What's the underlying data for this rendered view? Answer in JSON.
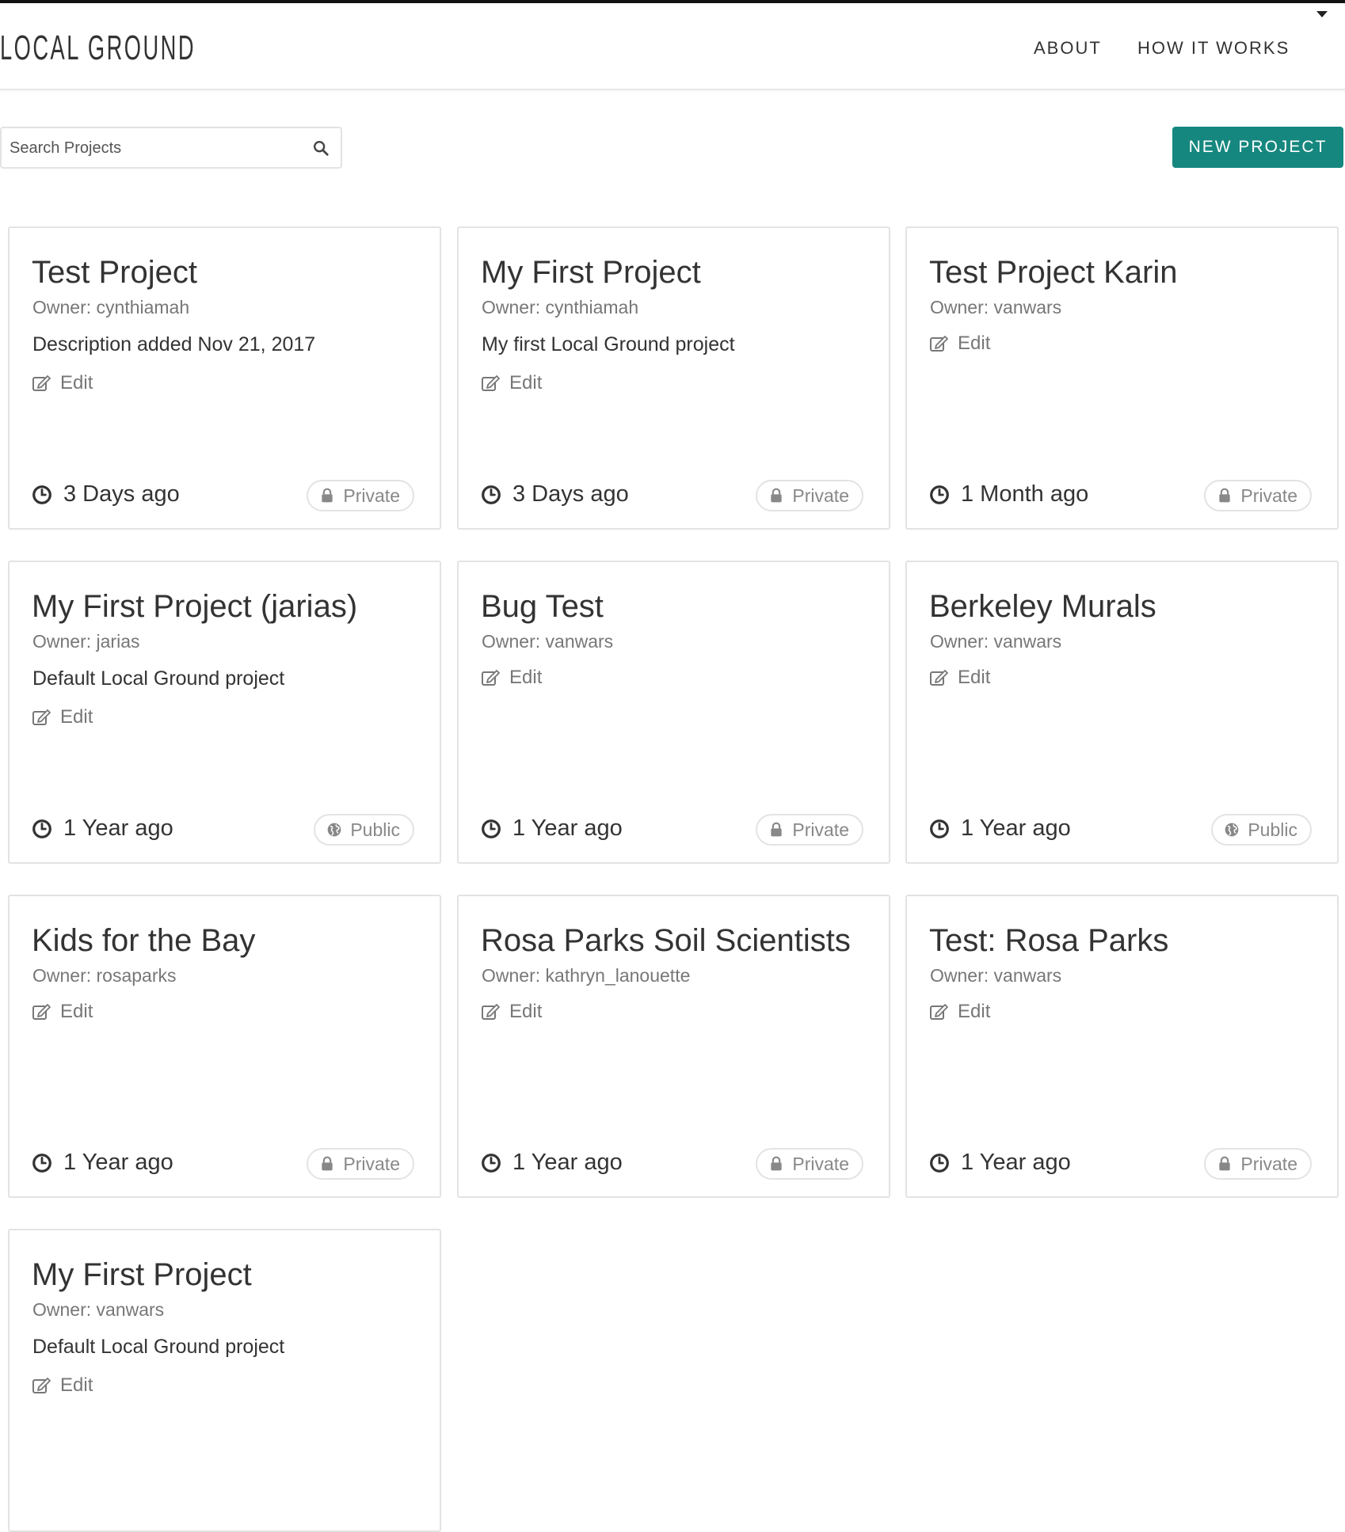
{
  "header": {
    "logo": "LOCAL GROUND",
    "nav": [
      "ABOUT",
      "HOW IT WORKS"
    ]
  },
  "search": {
    "placeholder": "Search Projects",
    "value": ""
  },
  "toolbar": {
    "new_project_label": "NEW PROJECT",
    "accent_color": "#16877f"
  },
  "projects": [
    {
      "title": "Test Project",
      "owner": "Owner: cynthiamah",
      "description": "Description added Nov 21, 2017",
      "edit": "Edit",
      "time": "3 Days ago",
      "visibility": "Private"
    },
    {
      "title": "My First Project",
      "owner": "Owner: cynthiamah",
      "description": "My first Local Ground project",
      "edit": "Edit",
      "time": "3 Days ago",
      "visibility": "Private"
    },
    {
      "title": "Test Project Karin",
      "owner": "Owner: vanwars",
      "description": "",
      "edit": "Edit",
      "time": "1 Month ago",
      "visibility": "Private"
    },
    {
      "title": "My First Project (jarias)",
      "owner": "Owner: jarias",
      "description": "Default Local Ground project",
      "edit": "Edit",
      "time": "1 Year ago",
      "visibility": "Public"
    },
    {
      "title": "Bug Test",
      "owner": "Owner: vanwars",
      "description": "",
      "edit": "Edit",
      "time": "1 Year ago",
      "visibility": "Private"
    },
    {
      "title": "Berkeley Murals",
      "owner": "Owner: vanwars",
      "description": "",
      "edit": "Edit",
      "time": "1 Year ago",
      "visibility": "Public"
    },
    {
      "title": "Kids for the Bay",
      "owner": "Owner: rosaparks",
      "description": "",
      "edit": "Edit",
      "time": "1 Year ago",
      "visibility": "Private"
    },
    {
      "title": "Rosa Parks Soil Scientists",
      "owner": "Owner: kathryn_lanouette",
      "description": "",
      "edit": "Edit",
      "time": "1 Year ago",
      "visibility": "Private"
    },
    {
      "title": "Test: Rosa Parks",
      "owner": "Owner: vanwars",
      "description": "",
      "edit": "Edit",
      "time": "1 Year ago",
      "visibility": "Private"
    },
    {
      "title": "My First Project",
      "owner": "Owner: vanwars",
      "description": "Default Local Ground project",
      "edit": "Edit",
      "time": "",
      "visibility": ""
    }
  ]
}
